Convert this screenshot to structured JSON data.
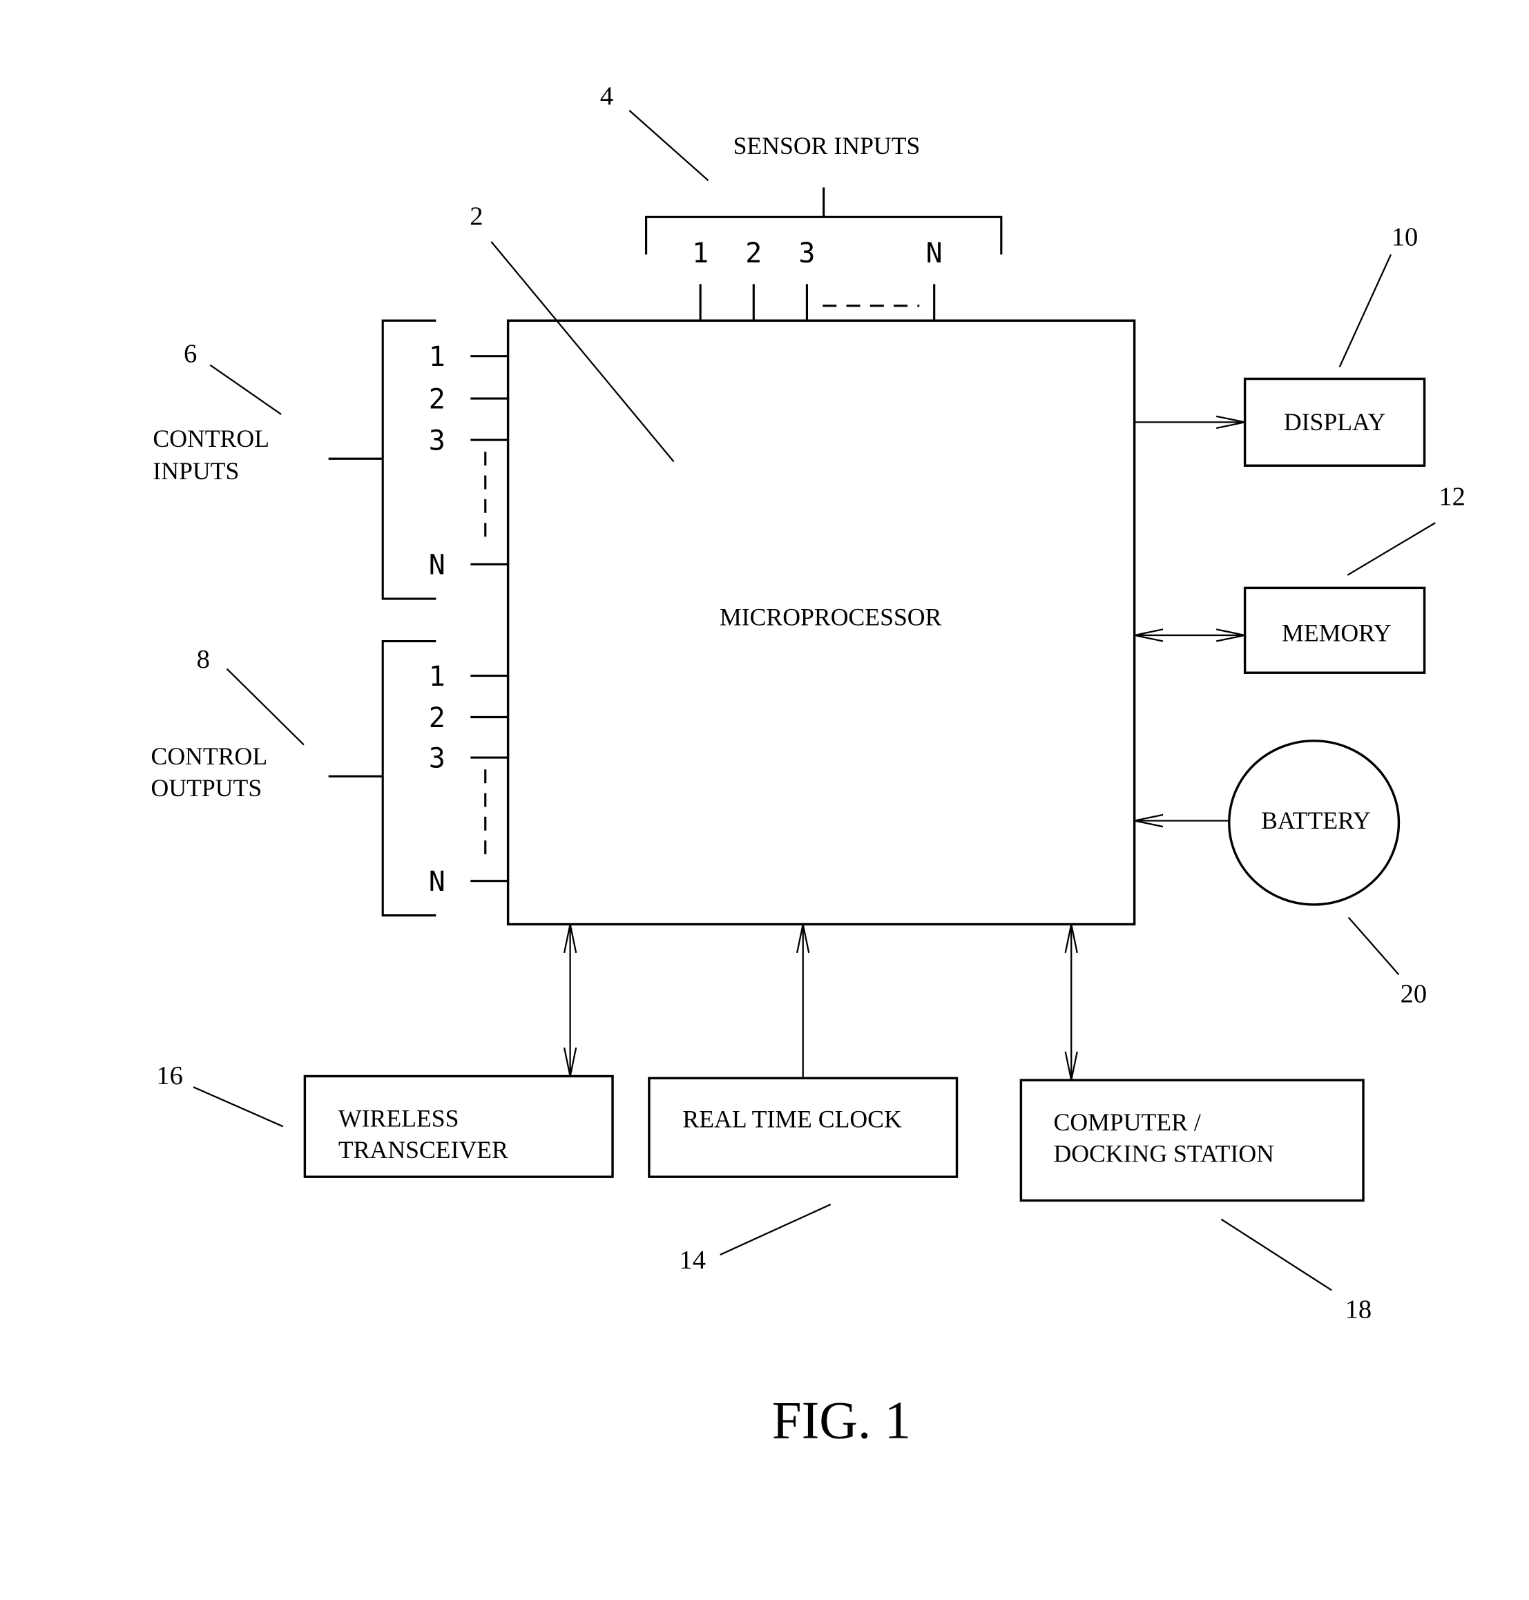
{
  "figure": {
    "caption": "FIG. 1",
    "colors": {
      "ink": "#000000",
      "background": "#ffffff"
    }
  },
  "microprocessor": {
    "label": "MICROPROCESSOR",
    "ref": "2"
  },
  "sensor_inputs": {
    "label": "SENSOR INPUTS",
    "ref": "4",
    "pins": [
      "1",
      "2",
      "3",
      "N"
    ]
  },
  "control_inputs": {
    "label_line1": "CONTROL",
    "label_line2": "INPUTS",
    "ref": "6",
    "pins": [
      "1",
      "2",
      "3",
      "N"
    ]
  },
  "control_outputs": {
    "label_line1": "CONTROL",
    "label_line2": "OUTPUTS",
    "ref": "8",
    "pins": [
      "1",
      "2",
      "3",
      "N"
    ]
  },
  "display": {
    "label": "DISPLAY",
    "ref": "10",
    "connection": "output"
  },
  "memory": {
    "label": "MEMORY",
    "ref": "12",
    "connection": "bidirectional"
  },
  "battery": {
    "label": "BATTERY",
    "ref": "20",
    "connection": "input"
  },
  "wireless_transceiver": {
    "label_line1": "WIRELESS",
    "label_line2": "TRANSCEIVER",
    "ref": "16",
    "connection": "bidirectional"
  },
  "real_time_clock": {
    "label": "REAL TIME CLOCK",
    "ref": "14",
    "connection": "input"
  },
  "computer_docking": {
    "label_line1": "COMPUTER /",
    "label_line2": "DOCKING STATION",
    "ref": "18",
    "connection": "bidirectional"
  }
}
